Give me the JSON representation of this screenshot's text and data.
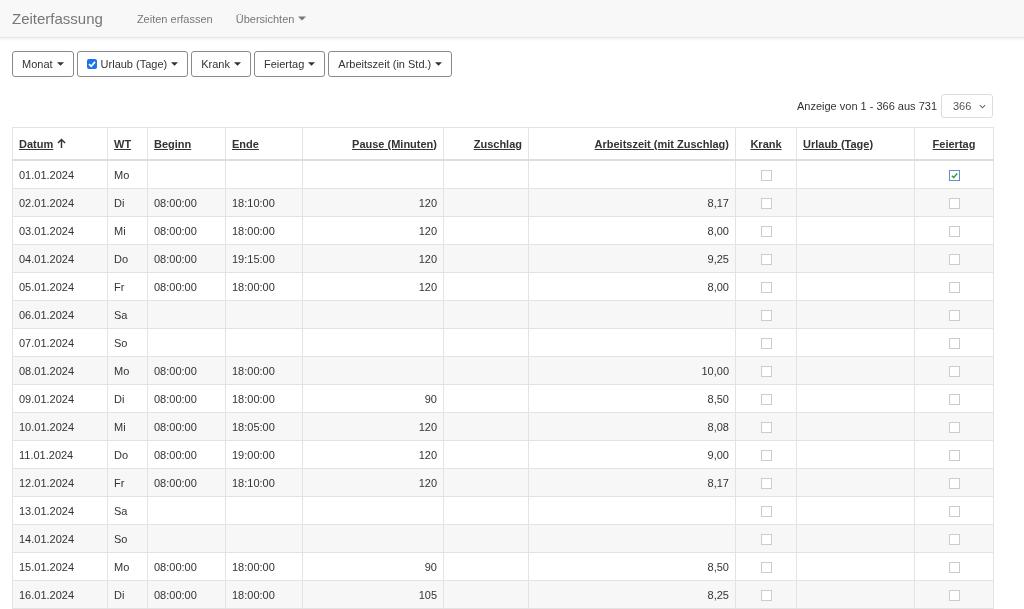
{
  "navbar": {
    "brand": "Zeiterfassung",
    "links": [
      {
        "label": "Zeiten erfassen",
        "dropdown": false
      },
      {
        "label": "Übersichten",
        "dropdown": true
      }
    ]
  },
  "filters": [
    {
      "label": "Monat",
      "checked": false
    },
    {
      "label": "Urlaub (Tage)",
      "checked": true
    },
    {
      "label": "Krank",
      "checked": false
    },
    {
      "label": "Feiertag",
      "checked": false
    },
    {
      "label": "Arbeitszeit (in Std.)",
      "checked": false
    }
  ],
  "pagination": {
    "info": "Anzeige von 1 - 366 aus 731",
    "page_size": "366"
  },
  "table": {
    "columns": [
      {
        "label": "Datum",
        "sorted": true
      },
      {
        "label": "WT",
        "sorted": false
      },
      {
        "label": "Beginn",
        "sorted": false
      },
      {
        "label": "Ende",
        "sorted": false
      },
      {
        "label": "Pause (Minuten)",
        "sorted": false
      },
      {
        "label": "Zuschlag",
        "sorted": false
      },
      {
        "label": "Arbeitszeit (mit Zuschlag)",
        "sorted": false
      },
      {
        "label": "Krank",
        "sorted": false
      },
      {
        "label": "Urlaub (Tage)",
        "sorted": false
      },
      {
        "label": "Feiertag",
        "sorted": false
      }
    ],
    "rows": [
      {
        "date": "01.01.2024",
        "weekday": "Mo",
        "sick": false,
        "holiday": true
      },
      {
        "date": "02.01.2024",
        "weekday": "Di",
        "begin": "08:00:00",
        "end": "18:10:00",
        "pause": "120",
        "hours": "8,17",
        "sick": false,
        "holiday": false
      },
      {
        "date": "03.01.2024",
        "weekday": "Mi",
        "begin": "08:00:00",
        "end": "18:00:00",
        "pause": "120",
        "hours": "8,00",
        "sick": false,
        "holiday": false
      },
      {
        "date": "04.01.2024",
        "weekday": "Do",
        "begin": "08:00:00",
        "end": "19:15:00",
        "pause": "120",
        "hours": "9,25",
        "sick": false,
        "holiday": false
      },
      {
        "date": "05.01.2024",
        "weekday": "Fr",
        "begin": "08:00:00",
        "end": "18:00:00",
        "pause": "120",
        "hours": "8,00",
        "sick": false,
        "holiday": false
      },
      {
        "date": "06.01.2024",
        "weekday": "Sa",
        "sick": false,
        "holiday": false
      },
      {
        "date": "07.01.2024",
        "weekday": "So",
        "sick": false,
        "holiday": false
      },
      {
        "date": "08.01.2024",
        "weekday": "Mo",
        "begin": "08:00:00",
        "end": "18:00:00",
        "hours": "10,00",
        "sick": false,
        "holiday": false
      },
      {
        "date": "09.01.2024",
        "weekday": "Di",
        "begin": "08:00:00",
        "end": "18:00:00",
        "pause": "90",
        "hours": "8,50",
        "sick": false,
        "holiday": false
      },
      {
        "date": "10.01.2024",
        "weekday": "Mi",
        "begin": "08:00:00",
        "end": "18:05:00",
        "pause": "120",
        "hours": "8,08",
        "sick": false,
        "holiday": false
      },
      {
        "date": "11.01.2024",
        "weekday": "Do",
        "begin": "08:00:00",
        "end": "19:00:00",
        "pause": "120",
        "hours": "9,00",
        "sick": false,
        "holiday": false
      },
      {
        "date": "12.01.2024",
        "weekday": "Fr",
        "begin": "08:00:00",
        "end": "18:10:00",
        "pause": "120",
        "hours": "8,17",
        "sick": false,
        "holiday": false
      },
      {
        "date": "13.01.2024",
        "weekday": "Sa",
        "sick": false,
        "holiday": false
      },
      {
        "date": "14.01.2024",
        "weekday": "So",
        "sick": false,
        "holiday": false
      },
      {
        "date": "15.01.2024",
        "weekday": "Mo",
        "begin": "08:00:00",
        "end": "18:00:00",
        "pause": "90",
        "hours": "8,50",
        "sick": false,
        "holiday": false
      },
      {
        "date": "16.01.2024",
        "weekday": "Di",
        "begin": "08:00:00",
        "end": "18:00:00",
        "pause": "105",
        "hours": "8,25",
        "sick": false,
        "holiday": false
      }
    ]
  }
}
